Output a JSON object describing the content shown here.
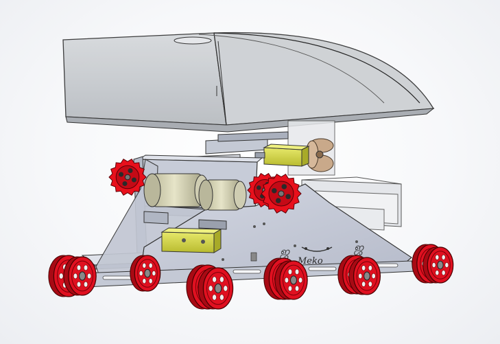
{
  "viewport": {
    "background": "#f4f5f7"
  },
  "model": {
    "plate_marks": {
      "mark_left": "ஜ",
      "mark_right": "ஜ",
      "brand": "Meko"
    },
    "colors": {
      "sprocket": "#e8101c",
      "wheel": "#e01020",
      "frame": "#c7ccd8",
      "canopy": "#c9ccd1",
      "motor": "#d6d84a",
      "roller": "#d8d6b8",
      "fan": "#c9a98a"
    }
  }
}
